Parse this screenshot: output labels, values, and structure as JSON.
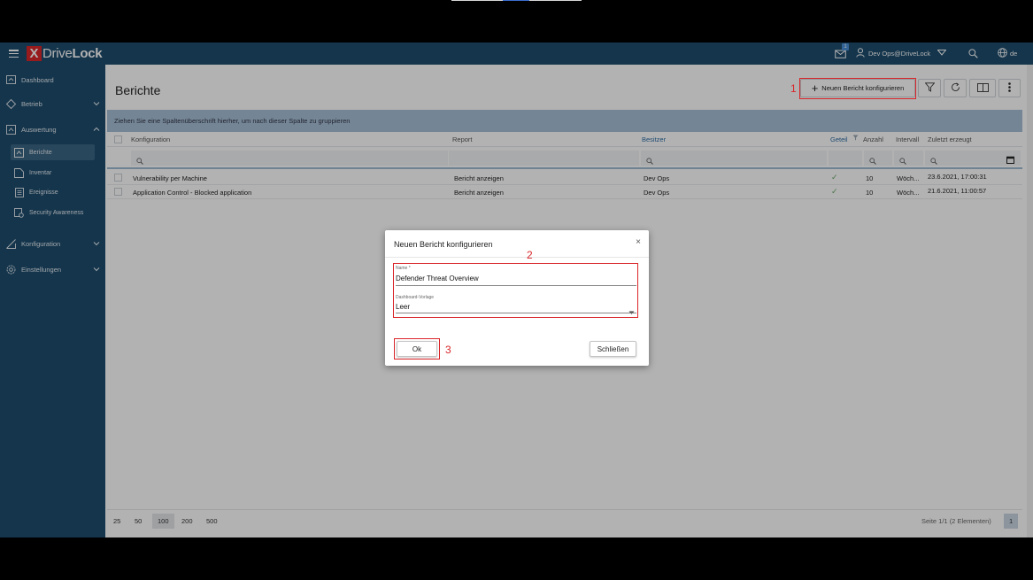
{
  "app": {
    "brand_x": "X",
    "brand_drive": "Drive",
    "brand_lock": "Lock",
    "notification_count": "1",
    "user": "Dev Ops@DriveLock",
    "language": "de",
    "icons": {
      "menu": "hamburger-icon",
      "mail": "mail-icon",
      "user": "user-icon",
      "search": "search-icon",
      "globe": "globe-icon"
    }
  },
  "sidebar": {
    "items": [
      {
        "label": "Dashboard",
        "icon": "dashboard-icon"
      },
      {
        "label": "Betrieb",
        "icon": "power-icon"
      },
      {
        "label": "Auswertung",
        "icon": "report-icon"
      },
      {
        "label": "Konfiguration",
        "icon": "config-icon"
      },
      {
        "label": "Einstellungen",
        "icon": "gear-icon"
      }
    ],
    "sub_items": [
      {
        "label": "Berichte",
        "icon": "report-icon"
      },
      {
        "label": "Inventar",
        "icon": "inventory-icon"
      },
      {
        "label": "Ereignisse",
        "icon": "events-icon"
      },
      {
        "label": "Security Awareness",
        "icon": "awareness-icon"
      }
    ]
  },
  "page": {
    "title": "Berichte",
    "new_report_button": "Neuen Bericht konfigurieren",
    "group_hint": "Ziehen Sie eine Spaltenüberschrift hierher, um nach dieser Spalte zu gruppieren"
  },
  "table": {
    "columns": [
      "Konfiguration",
      "Report",
      "Besitzer",
      "Geteil",
      "Anzahl",
      "Intervall",
      "Zuletzt erzeugt"
    ],
    "rows": [
      {
        "config": "Vulnerability per Machine",
        "report": "Bericht anzeigen",
        "owner": "Dev Ops",
        "shared": "✓",
        "count": "10",
        "interval": "Wöch...",
        "last": "23.6.2021, 17:00:31"
      },
      {
        "config": "Application Control - Blocked application",
        "report": "Bericht anzeigen",
        "owner": "Dev Ops",
        "shared": "✓",
        "count": "10",
        "interval": "Wöch...",
        "last": "21.6.2021, 11:00:57"
      }
    ]
  },
  "pager": {
    "sizes": [
      "25",
      "50",
      "100",
      "200",
      "500"
    ],
    "selected": "100",
    "info": "Seite 1/1 (2 Elementen)",
    "page": "1"
  },
  "dialog": {
    "title": "Neuen Bericht konfigurieren",
    "close": "×",
    "name_label": "Name *",
    "name_value": "Defender Threat Overview",
    "template_label": "Dashboard-Vorlage",
    "template_value": "Leer",
    "ok": "Ok",
    "close_button": "Schließen"
  },
  "annotations": [
    "1",
    "2",
    "3"
  ],
  "colors": {
    "header": "#1e4c6e",
    "accent": "#d9262a",
    "groupbar": "#a7c1d7"
  }
}
